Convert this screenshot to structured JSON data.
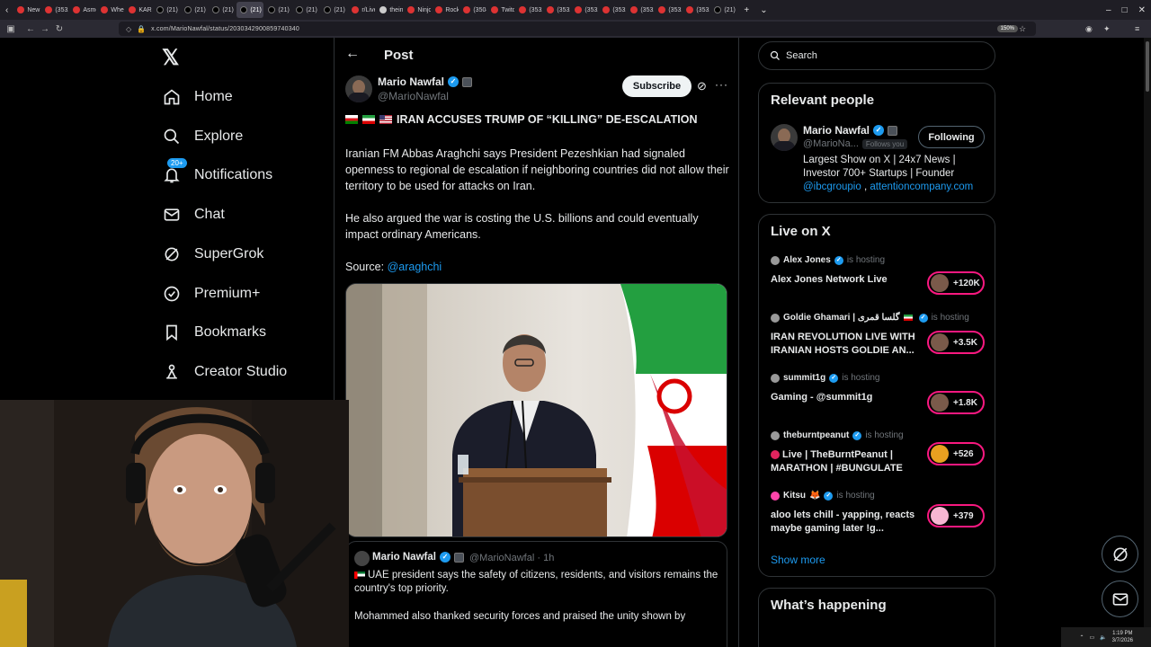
{
  "browser": {
    "tabs": [
      "New",
      "(3532",
      "Asmo",
      "Wher",
      "KARE",
      "(21) I",
      "(21) I",
      "(21) I",
      "(21)",
      "(21) 2",
      "(21) I",
      "(21) I",
      "r/Live",
      "theine",
      "Ninjo",
      "Rocke",
      "(3504",
      "Twitc",
      "(3532",
      "(3532",
      "(3532",
      "(3532",
      "(3532",
      "(3532",
      "(3532",
      "(21) I"
    ],
    "url": "x.com/MarioNawfal/status/2030342900859740340",
    "zoom": "150%"
  },
  "nav": {
    "items": [
      {
        "label": "Home",
        "icon": "home-icon"
      },
      {
        "label": "Explore",
        "icon": "search-icon"
      },
      {
        "label": "Notifications",
        "icon": "bell-icon",
        "badge": "20+"
      },
      {
        "label": "Chat",
        "icon": "mail-icon"
      },
      {
        "label": "SuperGrok",
        "icon": "grok-icon"
      },
      {
        "label": "Premium+",
        "icon": "verified-icon"
      },
      {
        "label": "Bookmarks",
        "icon": "bookmark-icon"
      },
      {
        "label": "Creator Studio",
        "icon": "creator-icon"
      }
    ]
  },
  "post": {
    "header": "Post",
    "author_name": "Mario Nawfal",
    "author_handle": "@MarioNawfal",
    "subscribe_label": "Subscribe",
    "headline": "IRAN ACCUSES TRUMP OF “KILLING” DE-ESCALATION",
    "paragraph1": "Iranian FM Abbas Araghchi says President Pezeshkian had signaled openness to regional de escalation if neighboring countries did not allow their territory to be used for attacks on Iran.",
    "paragraph2": "He also argued the war is costing the U.S. billions and could eventually impact ordinary Americans.",
    "source_label": "Source: ",
    "source_handle": "@araghchi",
    "quote": {
      "author_name": "Mario Nawfal",
      "author_handle": "@MarioNawfal · 1h",
      "text1": "UAE president says the safety of citizens, residents, and visitors remains the country's top priority.",
      "text2": "Mohammed also thanked security forces and praised the unity shown by"
    }
  },
  "sidebar": {
    "search_placeholder": "Search",
    "relevant": {
      "title": "Relevant people",
      "name": "Mario Nawfal",
      "handle": "@MarioNa...",
      "follows_you": "Follows you",
      "following_label": "Following",
      "bio": "Largest Show on X | 24x7 News | Investor 700+ Startups | Founder",
      "bio_link1": "@ibcgroupio",
      "bio_sep": " , ",
      "bio_link2": "attentioncompany.com"
    },
    "live": {
      "title": "Live on X",
      "hosting_label": "is hosting",
      "items": [
        {
          "host": "Alex Jones",
          "title": "Alex Jones Network Live",
          "count": "+120K"
        },
        {
          "host": "Goldie Ghamari | گلسا قمری",
          "title": "IRAN REVOLUTION LIVE WITH IRANIAN HOSTS GOLDIE AN...",
          "count": "+3.5K"
        },
        {
          "host": "summit1g",
          "title": "Gaming - @summit1g",
          "count": "+1.8K"
        },
        {
          "host": "theburntpeanut",
          "title": "Live | TheBurntPeanut | MARATHON | #BUNGULATE",
          "count": "+526"
        },
        {
          "host": "Kitsu",
          "title": "aloo lets chill - yapping, reacts maybe gaming later !g...",
          "count": "+379"
        }
      ],
      "show_more": "Show more"
    },
    "happening_title": "What’s happening"
  },
  "taskbar": {
    "time": "1:19 PM",
    "date": "3/7/2026"
  }
}
